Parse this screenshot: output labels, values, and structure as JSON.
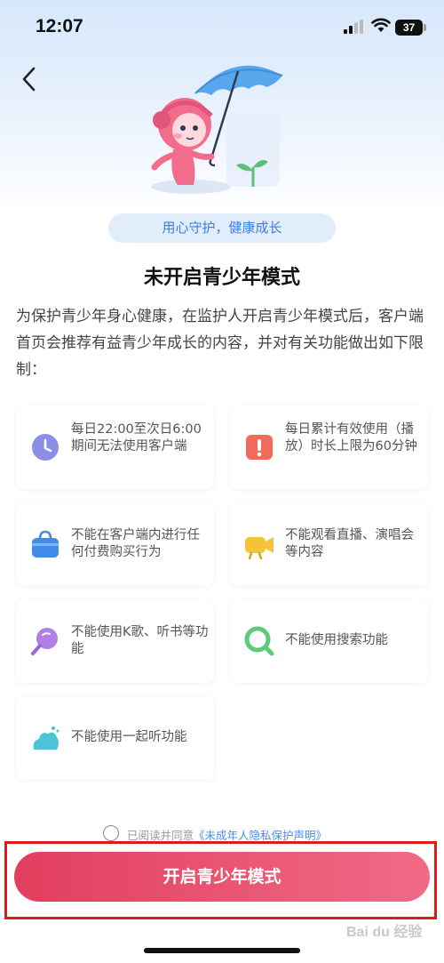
{
  "status_bar": {
    "time": "12:07",
    "battery": "37"
  },
  "header": {
    "back_icon": "chevron-left-icon"
  },
  "slogan": "用心守护，健康成长",
  "title": "未开启青少年模式",
  "intro": "为保护青少年身心健康，在监护人开启青少年模式后，客户端首页会推荐有益青少年成长的内容，并对有关功能做出如下限制：",
  "restrictions": [
    {
      "icon": "clock-icon",
      "color": "#8a8ee6",
      "text": "每日22:00至次日6:00期间无法使用客户端"
    },
    {
      "icon": "timer-icon",
      "color": "#f26a5a",
      "text": "每日累计有效使用（播放）时长上限为60分钟"
    },
    {
      "icon": "shopping-bag-icon",
      "color": "#3f8de8",
      "text": "不能在客户端内进行任何付费购买行为"
    },
    {
      "icon": "video-camera-icon",
      "color": "#f5c33b",
      "text": "不能观看直播、演唱会等内容"
    },
    {
      "icon": "microphone-icon",
      "color": "#b27ee8",
      "text": "不能使用K歌、听书等功能"
    },
    {
      "icon": "search-icon",
      "color": "#5cc97d",
      "text": "不能使用搜索功能"
    },
    {
      "icon": "listen-together-icon",
      "color": "#4cc3d6",
      "text": "不能使用一起听功能"
    }
  ],
  "agreement": {
    "prefix": "已阅读并同意",
    "link": "《未成年人隐私保护声明》"
  },
  "primary_button": "开启青少年模式",
  "watermark": "Bai du 经验"
}
